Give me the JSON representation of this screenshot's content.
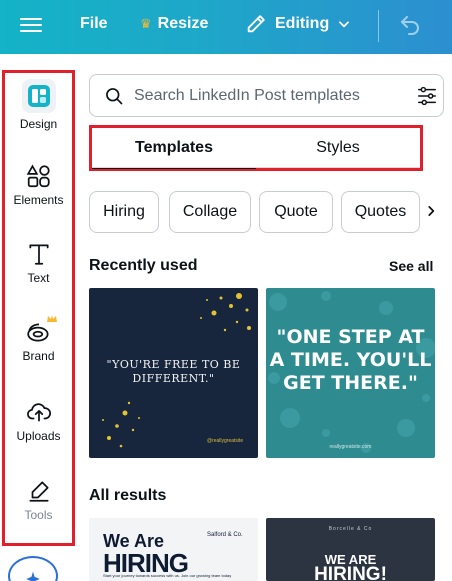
{
  "topbar": {
    "file_label": "File",
    "resize_label": "Resize",
    "editing_label": "Editing",
    "gradient_start": "#14b3c7",
    "gradient_end": "#2c8fd0"
  },
  "sidebar": {
    "items": [
      {
        "label": "Design",
        "icon": "design-icon",
        "active": true
      },
      {
        "label": "Elements",
        "icon": "elements-icon"
      },
      {
        "label": "Text",
        "icon": "text-icon"
      },
      {
        "label": "Brand",
        "icon": "brand-icon",
        "badge": "crown-icon"
      },
      {
        "label": "Uploads",
        "icon": "uploads-icon"
      },
      {
        "label": "Tools",
        "icon": "tools-icon"
      }
    ],
    "highlight_color": "#e0202a"
  },
  "search": {
    "placeholder": "Search LinkedIn Post templates",
    "value": ""
  },
  "tabs": [
    {
      "label": "Templates",
      "active": true
    },
    {
      "label": "Styles",
      "active": false
    }
  ],
  "chips": [
    "Hiring",
    "Collage",
    "Quote",
    "Quotes"
  ],
  "recent": {
    "title": "Recently used",
    "see_all": "See all",
    "templates": [
      {
        "text": "\"YOU'RE FREE TO BE DIFFERENT.\"",
        "footer": "@reallygreatsite",
        "bg": "#18263d"
      },
      {
        "text": "\"ONE STEP AT A TIME. YOU'LL GET THERE.\"",
        "footer": "reallygreatsite.com",
        "bg": "#2e8c91"
      }
    ]
  },
  "all_results": {
    "title": "All results",
    "templates": [
      {
        "line1": "We Are",
        "line2": "HIRING",
        "brand": "Salford & Co.",
        "sub": "Start your journey towards success with us. Join our growing team today",
        "bg": "#f3f4f6"
      },
      {
        "brand": "Borcelle & Co",
        "line1": "WE ARE",
        "line2": "HIRING!",
        "bg": "#2b3440"
      }
    ]
  }
}
